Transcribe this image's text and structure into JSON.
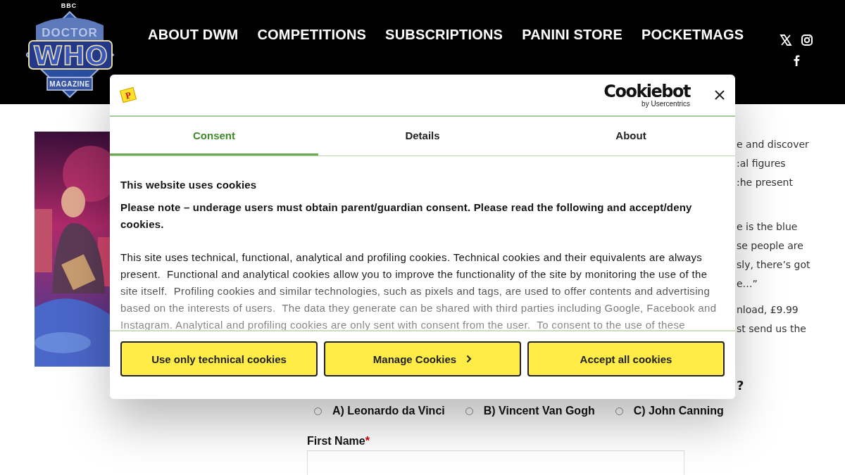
{
  "header": {
    "logo": {
      "bbc": "BBC",
      "line1": "DOCTOR",
      "line2": "WHO",
      "line3": "MAGAZINE"
    },
    "nav": [
      {
        "label": "ABOUT DWM"
      },
      {
        "label": "COMPETITIONS"
      },
      {
        "label": "SUBSCRIPTIONS"
      },
      {
        "label": "PANINI STORE"
      },
      {
        "label": "POCKETMAGS"
      }
    ],
    "social": [
      {
        "kind": "x"
      },
      {
        "kind": "instagram"
      },
      {
        "kind": "facebook"
      }
    ]
  },
  "page": {
    "cover": {
      "kind": "picture"
    },
    "article_fragments": [
      [
        "e and discover",
        ":al figures",
        ":he present"
      ],
      [
        "e is the blue",
        "se people are",
        "sly, there’s got",
        "e…”"
      ],
      [
        "nload, £9.99",
        "st send us the"
      ]
    ],
    "question_fragment": "?",
    "options": [
      {
        "label": "A) Leonardo da Vinci",
        "selected": false
      },
      {
        "label": "B) Vincent Van Gogh",
        "selected": false
      },
      {
        "label": "C) John Canning",
        "selected": false
      }
    ],
    "fields": [
      {
        "label": "First Name",
        "required_mark": "*"
      }
    ]
  },
  "cookie_dialog": {
    "site_logo_letter": "P",
    "brand": "Cookiebot",
    "brand_sub": "by Usercentrics",
    "tabs": [
      {
        "label": "Consent",
        "selected": true
      },
      {
        "label": "Details",
        "selected": false
      },
      {
        "label": "About",
        "selected": false
      }
    ],
    "heading": "This website uses cookies",
    "notice": "Please note – underage users must obtain parent/guardian consent. Please read the following and accept/deny cookies.",
    "body": "This site uses technical, functional, analytical and profiling cookies. Technical cookies and their equivalents are always present.  Functional and analytical cookies allow you to improve the functionality of the site by monitoring the use of the site itself.  Profiling cookies and similar technologies, such as pixels and tags, are used to offer contents and advertising based on the interests of users.  The data they generate can be shared with third parties including Google, Facebook and Instagram. Analytical and profiling cookies are only sent with consent from the user.  To consent to the use of these",
    "buttons": [
      {
        "label": "Use only technical cookies",
        "kind": "plain"
      },
      {
        "label": "Manage Cookies",
        "kind": "chevron"
      },
      {
        "label": "Accept all cookies",
        "kind": "plain"
      }
    ]
  }
}
